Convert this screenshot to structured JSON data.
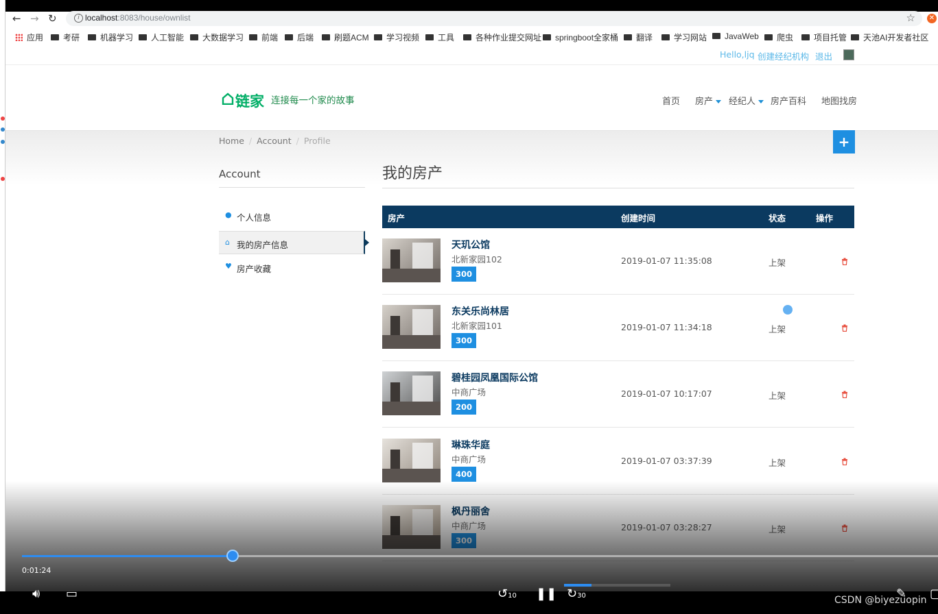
{
  "browser": {
    "url_host": "localhost",
    "url_rest": ":8083/house/ownlist",
    "bookmarks": [
      "应用",
      "考研",
      "机器学习",
      "人工智能",
      "大数据学习",
      "前端",
      "后端",
      "刷题ACM",
      "学习视频",
      "工具",
      "各种作业提交网址",
      "springboot全家桶",
      "翻译",
      "学习网站",
      "JavaWeb",
      "爬虫",
      "项目托管",
      "天池AI开发者社区"
    ]
  },
  "topbar": {
    "hello": "Hello,ljq",
    "create_agency": "创建经纪机构",
    "logout": "退出"
  },
  "header": {
    "brand": "链家",
    "slogan": "连接每一个家的故事",
    "menu": [
      "首页",
      "房产",
      "经纪人",
      "房产百科",
      "地图找房"
    ]
  },
  "breadcrumb": {
    "home": "Home",
    "account": "Account",
    "profile": "Profile"
  },
  "add_button": "+",
  "sidebar": {
    "title": "Account",
    "items": [
      {
        "label": "个人信息",
        "icon": "user-icon"
      },
      {
        "label": "我的房产信息",
        "icon": "home-icon"
      },
      {
        "label": "房产收藏",
        "icon": "heart-icon"
      }
    ]
  },
  "main": {
    "title": "我的房产",
    "columns": [
      "房产",
      "创建时间",
      "状态",
      "操作"
    ],
    "rows": [
      {
        "name": "天玑公馆",
        "address": "北新家园102",
        "price": "300",
        "time": "2019-01-07 11:35:08",
        "status": "上架"
      },
      {
        "name": "东关乐尚林居",
        "address": "北新家园101",
        "price": "300",
        "time": "2019-01-07 11:34:18",
        "status": "上架"
      },
      {
        "name": "碧桂园凤凰国际公馆",
        "address": "中商广场",
        "price": "200",
        "time": "2019-01-07 10:17:07",
        "status": "上架"
      },
      {
        "name": "琳珠华庭",
        "address": "中商广场",
        "price": "400",
        "time": "2019-01-07 03:37:39",
        "status": "上架"
      },
      {
        "name": "枫丹丽舍",
        "address": "中商广场",
        "price": "300",
        "time": "2019-01-07 03:28:27",
        "status": "上架"
      }
    ]
  },
  "video": {
    "time": "0:01:24",
    "progress": 0.23,
    "skip_back": "10",
    "skip_fwd": "30",
    "watermark": "CSDN @biyezuopin"
  },
  "colors": {
    "accent": "#1e8fe1",
    "navy": "#0b3a60",
    "brand_green": "#00ae66",
    "delete_red": "#e74c3c"
  }
}
